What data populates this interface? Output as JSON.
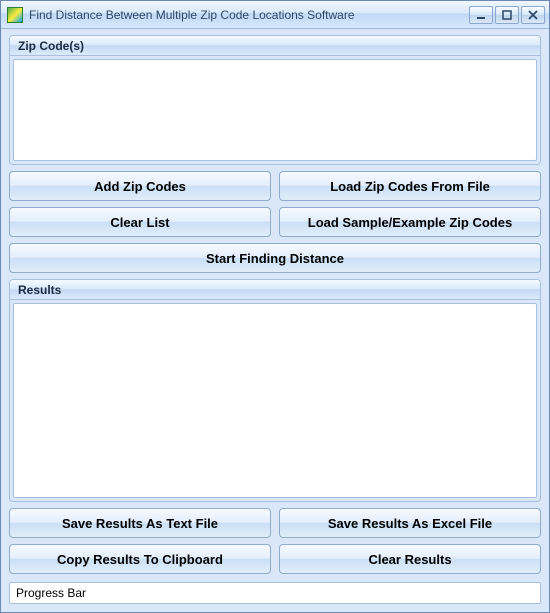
{
  "window": {
    "title": "Find Distance Between Multiple Zip Code Locations Software"
  },
  "groups": {
    "zip_label": "Zip Code(s)",
    "results_label": "Results"
  },
  "buttons": {
    "add_zip": "Add Zip Codes",
    "load_file": "Load Zip Codes From File",
    "clear_list": "Clear List",
    "load_sample": "Load Sample/Example Zip Codes",
    "start": "Start Finding Distance",
    "save_text": "Save Results As Text File",
    "save_excel": "Save Results As Excel File",
    "copy_clip": "Copy Results To Clipboard",
    "clear_results": "Clear Results"
  },
  "status": {
    "progress": "Progress Bar"
  }
}
